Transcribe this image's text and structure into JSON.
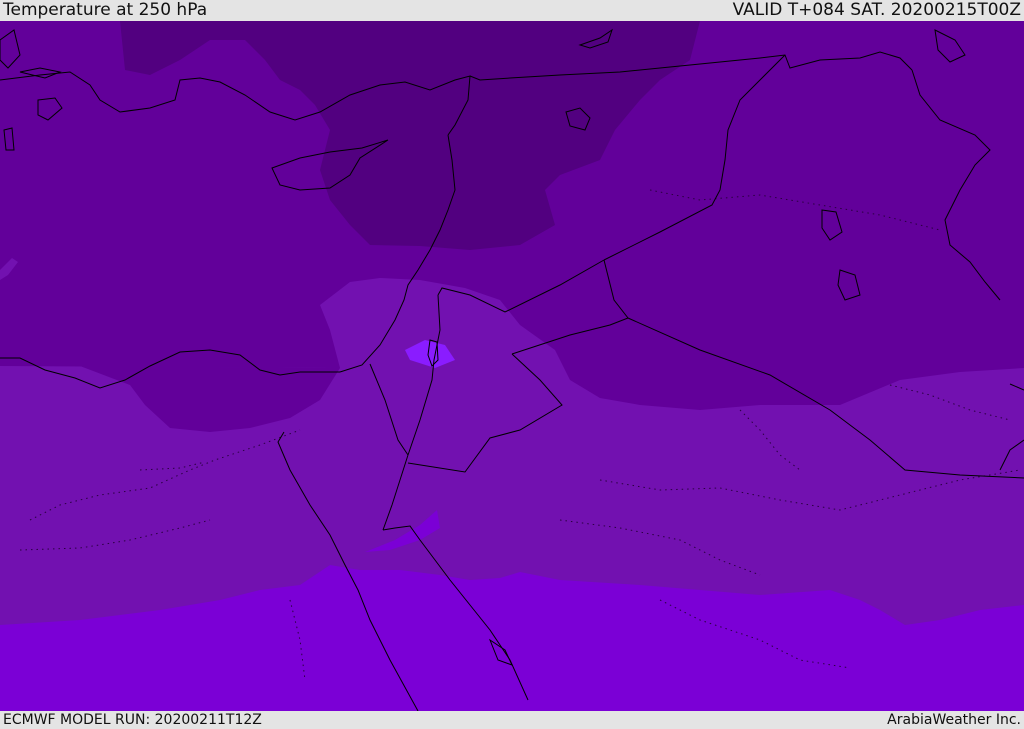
{
  "header": {
    "title": "Temperature at 250 hPa",
    "valid": "VALID T+084 SAT. 20200215T00Z"
  },
  "footer": {
    "model_run": "ECMWF MODEL RUN: 20200211T12Z",
    "credit": "ArabiaWeather Inc."
  },
  "colors": {
    "coldest": "#520080",
    "cold": "#62009a",
    "medium": "#7211b0",
    "warm": "#7b00d6",
    "bright_spot": "#8a1cff",
    "borders": "#000000",
    "frame": "#e4e4e4"
  }
}
